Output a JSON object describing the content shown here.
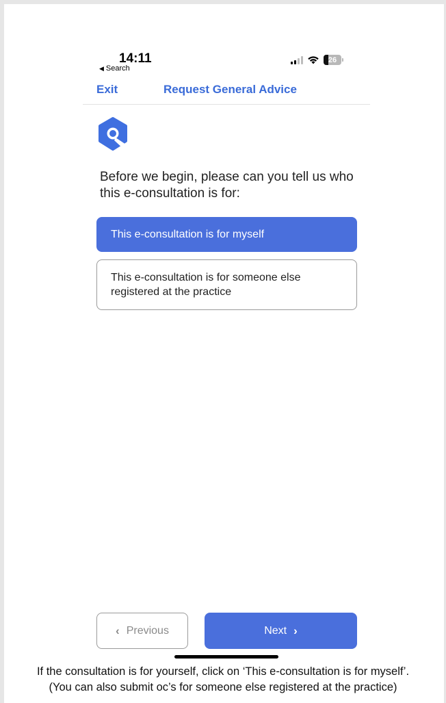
{
  "status_bar": {
    "time": "14:11",
    "back_label": "Search",
    "back_arrow": "◀",
    "battery_level": "26"
  },
  "nav": {
    "exit_label": "Exit",
    "title": "Request General Advice"
  },
  "logo_icon": "consultation-logo-icon",
  "question": "Before we begin, please can you tell us who this e-consultation is for:",
  "options": [
    {
      "label": "This e-consultation is for myself",
      "selected": true
    },
    {
      "label": "This e-consultation is for someone else registered at the practice",
      "selected": false
    }
  ],
  "buttons": {
    "previous_label": "Previous",
    "previous_icon": "‹",
    "next_label": "Next",
    "next_icon": "›"
  },
  "caption": {
    "line1": "If the consultation is for yourself, click on ‘This e-consultation is for myself’.",
    "line2": "(You can also submit oc’s for someone else registered at the practice)"
  },
  "colors": {
    "accent": "#4a6fdc",
    "nav_text": "#3a6bd8",
    "border": "#9a9a9a"
  }
}
